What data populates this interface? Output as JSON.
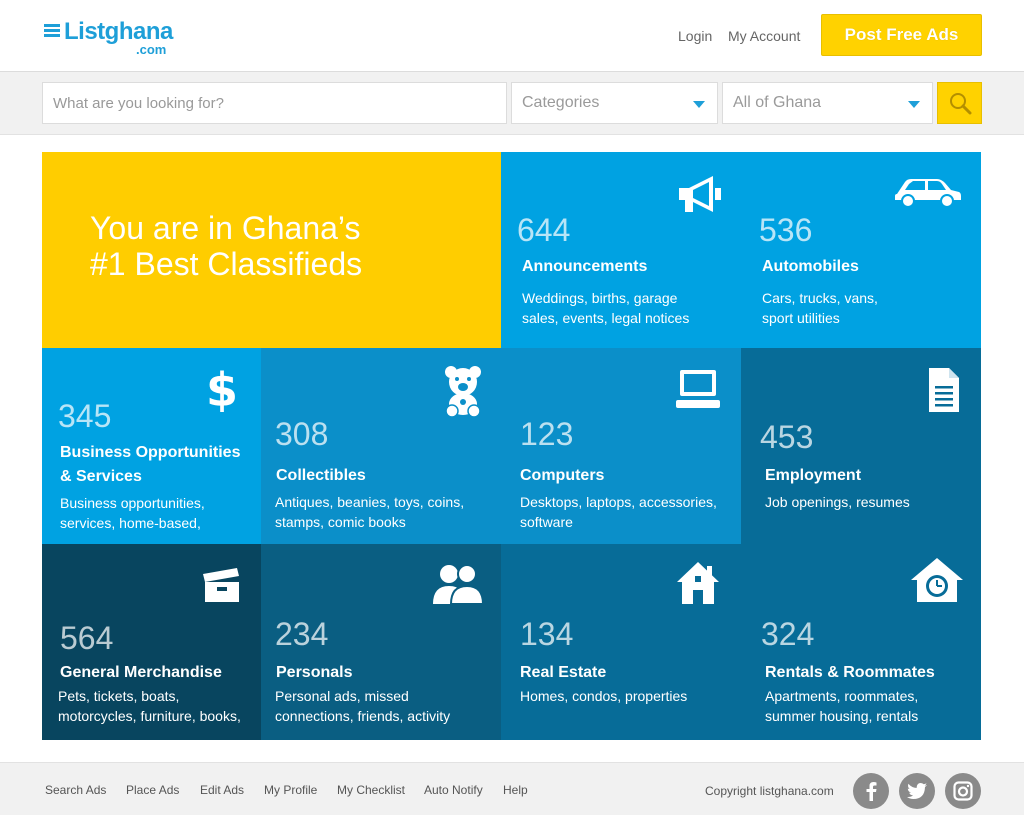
{
  "header": {
    "logo_name": "Listghana",
    "logo_sub": ".com",
    "login": "Login",
    "my_account": "My Account",
    "post_ads": "Post Free Ads"
  },
  "search": {
    "placeholder": "What are you looking for?",
    "category": "Categories",
    "location": "All of Ghana"
  },
  "hero": {
    "line1": "You are in Ghana’s",
    "line2": "#1 Best Classifieds"
  },
  "categories": [
    {
      "count": "644",
      "name": "Announcements",
      "desc1": "Weddings, births, garage",
      "desc2": "sales, events, legal notices",
      "icon": "megaphone-icon"
    },
    {
      "count": "536",
      "name": "Automobiles",
      "desc1": "Cars, trucks, vans,",
      "desc2": "sport utilities",
      "icon": "car-icon"
    },
    {
      "count": "345",
      "name1": "Business Opportunities",
      "name2": "& Services",
      "desc1": "Business opportunities,",
      "desc2": "services, home-based,",
      "icon": "dollar-icon"
    },
    {
      "count": "308",
      "name": "Collectibles",
      "desc1": "Antiques, beanies, toys, coins,",
      "desc2": "stamps, comic books",
      "icon": "teddy-bear-icon"
    },
    {
      "count": "123",
      "name": "Computers",
      "desc1": "Desktops, laptops, accessories,",
      "desc2": "software",
      "icon": "laptop-icon"
    },
    {
      "count": "453",
      "name": "Employment",
      "desc1": "Job openings, resumes",
      "desc2": "",
      "icon": "document-icon"
    },
    {
      "count": "564",
      "name": "General Merchandise",
      "desc1": "Pets, tickets, boats,",
      "desc2": "motorcycles, furniture, books,",
      "icon": "box-icon"
    },
    {
      "count": "234",
      "name": "Personals",
      "desc1": "Personal ads, missed",
      "desc2": "connections, friends, activity",
      "icon": "people-icon"
    },
    {
      "count": "134",
      "name": "Real Estate",
      "desc1": "Homes, condos, properties",
      "desc2": "",
      "icon": "house-icon"
    },
    {
      "count": "324",
      "name": "Rentals & Roommates",
      "desc1": "Apartments, roommates,",
      "desc2": "summer housing, rentals",
      "icon": "house-clock-icon"
    }
  ],
  "footer": {
    "links": [
      "Search Ads",
      "Place Ads",
      "Edit Ads",
      "My Profile",
      "My Checklist",
      "Auto Notify",
      "Help"
    ],
    "copyright": "Copyright listghana.com"
  },
  "colors": {
    "brand_blue": "#1e9fd8",
    "accent_yellow": "#ffd200",
    "tile_light": "#00a2e2",
    "tile_mid": "#0b8fc9",
    "tile_dark": "#076c98",
    "tile_darker": "#0a5e82",
    "tile_darkest": "#08455f"
  }
}
